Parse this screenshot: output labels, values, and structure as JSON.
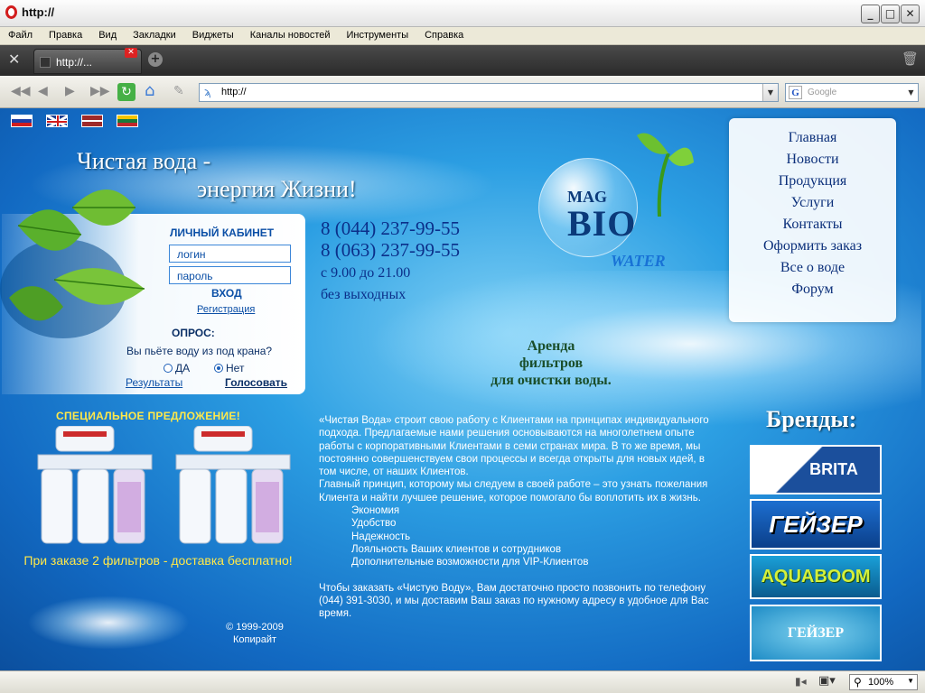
{
  "window": {
    "title": "http://",
    "min": "_",
    "max": "□",
    "close": "✕"
  },
  "menu": [
    "Файл",
    "Правка",
    "Вид",
    "Закладки",
    "Виджеты",
    "Каналы новостей",
    "Инструменты",
    "Справка"
  ],
  "tab": {
    "label": "http://..."
  },
  "address": {
    "value": "http://"
  },
  "search": {
    "placeholder": "Google"
  },
  "site": {
    "slogan_line1": "Чистая вода -",
    "slogan_line2": "энергия Жизни!",
    "cabinet": {
      "title": "ЛИЧНЫЙ КАБИНЕТ",
      "login_placeholder": "логин",
      "password_placeholder": "пароль",
      "enter": "ВХОД",
      "register": "Регистрация"
    },
    "poll": {
      "title": "ОПРОС:",
      "question": "Вы пьёте воду из под крана?",
      "yes": "ДА",
      "no": "Нет",
      "results": "Результаты",
      "vote": "Голосовать"
    },
    "phones": [
      "8 (044) 237-99-55",
      "8 (063) 237-99-55"
    ],
    "hours": "с 9.00 до 21.00",
    "days": "без выходных",
    "logo": {
      "mag": "MAG",
      "bio": "BIO",
      "water": "WATER"
    },
    "rent": [
      "Аренда",
      "фильтров",
      "для очистки воды."
    ],
    "nav": [
      "Главная",
      "Новости",
      "Продукция",
      "Услуги",
      "Контакты",
      "Оформить заказ",
      "Все о воде",
      "Форум"
    ],
    "special": "СПЕЦИАЛЬНОЕ ПРЕДЛОЖЕНИЕ!",
    "promo": "При заказе 2 фильтров - доставка бесплатно!",
    "copyright": [
      "© 1999-2009",
      "Копирайт"
    ],
    "body_p1": "«Чистая Вода» строит свою работу с Клиентами на принципах индивидуального подхода. Предлагаемые нами решения основываются на многолетнем опыте работы с корпоративными Клиентами в семи странах мира. В то же время, мы постоянно совершенствуем свои процессы и всегда открыты для новых идей, в том числе, от наших Клиентов.",
    "body_p2": "Главный принцип, которому мы следуем в своей работе – это узнать пожелания Клиента и найти лучшее решение, которое помогало бы воплотить их в жизнь.",
    "body_list": [
      "Экономия",
      "Удобство",
      "Надежность",
      "Лояльность Ваших клиентов и сотрудников",
      "Дополнительные возможности для VIP-Клиентов"
    ],
    "body_p3": "Чтобы заказать «Чистую Воду», Вам достаточно просто позвонить по телефону (044) 391-3030, и мы доставим Ваш заказ по нужному адресу в удобное для Вас время.",
    "brands_title": "Бренды:",
    "brands": [
      "BRITA",
      "ГЕЙЗЕР",
      "AQUABOOM",
      "ГЕЙЗЕР"
    ]
  },
  "status": {
    "zoom": "100%"
  }
}
